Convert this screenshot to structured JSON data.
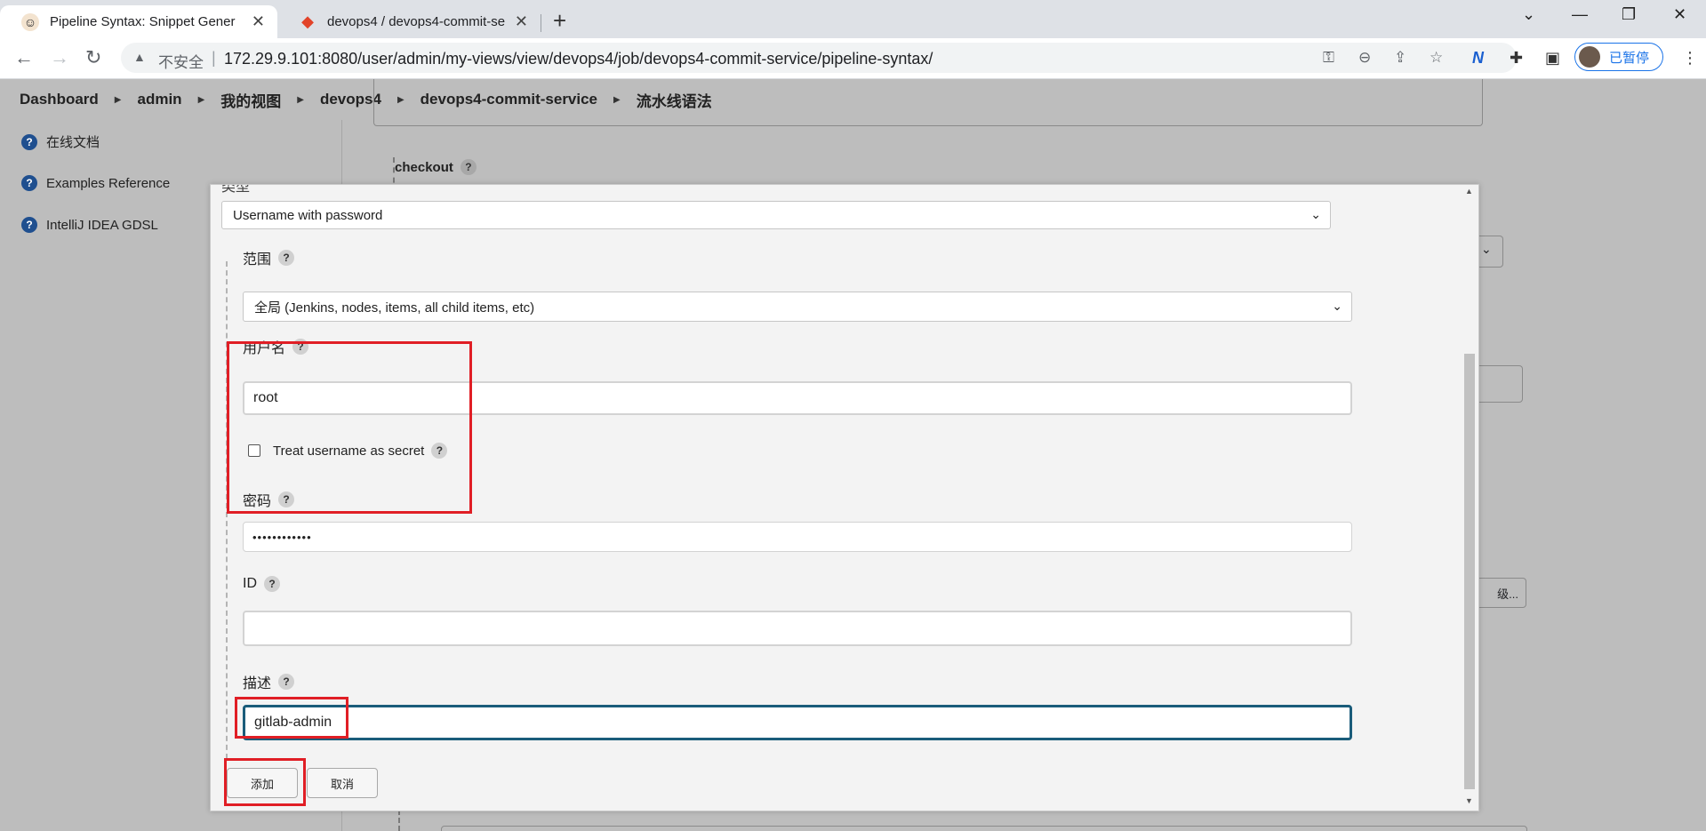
{
  "browser": {
    "tabs": [
      {
        "title": "Pipeline Syntax: Snippet Gener",
        "icon": "jenkins-icon",
        "active": true
      },
      {
        "title": "devops4 / devops4-commit-se",
        "icon": "gitlab-icon",
        "active": false
      }
    ],
    "insecure_label": "不安全",
    "url": "172.29.9.101:8080/user/admin/my-views/view/devops4/job/devops4-commit-service/pipeline-syntax/",
    "profile_label": "已暂停"
  },
  "breadcrumb": [
    "Dashboard",
    "admin",
    "我的视图",
    "devops4",
    "devops4-commit-service",
    "流水线语法"
  ],
  "sidebar": [
    {
      "label": "在线文档"
    },
    {
      "label": "Examples Reference"
    },
    {
      "label": "IntelliJ IDEA GDSL"
    }
  ],
  "background": {
    "checkout_label": "checkout",
    "partial_button": "级...",
    "help": "?"
  },
  "dialog": {
    "kind_label": "类型",
    "kind_value": "Username with password",
    "scope_label": "范围",
    "scope_value": "全局 (Jenkins, nodes, items, all child items, etc)",
    "username_label": "用户名",
    "username_value": "root",
    "treat_secret_label": "Treat username as secret",
    "password_label": "密码",
    "password_value": "••••••••••••",
    "id_label": "ID",
    "id_value": "",
    "description_label": "描述",
    "description_value": "gitlab-admin",
    "add_button": "添加",
    "cancel_button": "取消",
    "help": "?"
  },
  "colors": {
    "highlight": "#e01e25",
    "focus": "#1a5c7a"
  }
}
